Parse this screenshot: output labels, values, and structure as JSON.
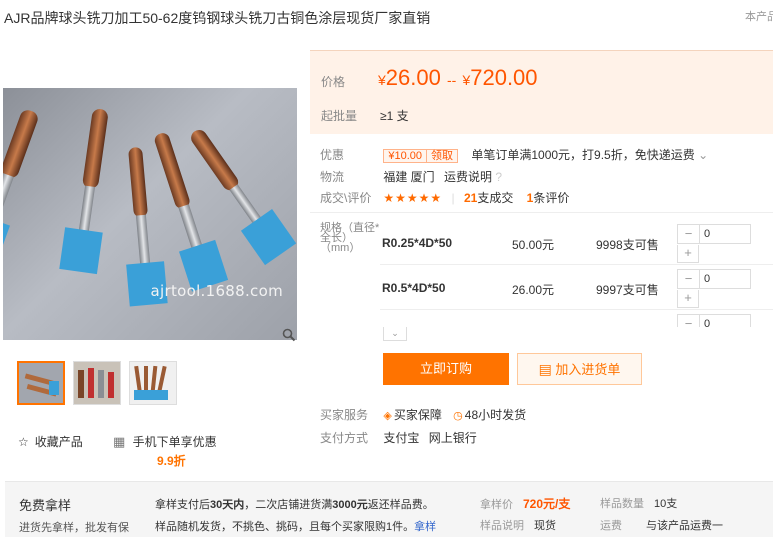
{
  "product": {
    "title": "AJR品牌球头铣刀加工50-62度钨钢球头铣刀古铜色涂层现货厂家直销",
    "corner_note": "本产品"
  },
  "gallery": {
    "watermark": "ajrtool.1688.com",
    "thumbs": [
      "thumb-1",
      "thumb-2",
      "thumb-3"
    ]
  },
  "actions": {
    "favorite_label": "收藏产品",
    "mobile_label": "手机下单享优惠",
    "mobile_discount": "9.9折"
  },
  "pricing": {
    "price_label": "价格",
    "price_low": "26.00",
    "price_sep": "--",
    "price_high": "720.00",
    "currency": "¥",
    "moq_label": "起批量",
    "moq_value": "≥1 支"
  },
  "info": {
    "promo_label": "优惠",
    "coupon_amount": "¥10.00",
    "coupon_action": "领取",
    "promo_text": "单笔订单满1000元，打9.5折，免快递运费",
    "logistics_label": "物流",
    "logistics_value": "福建 厦门",
    "freight_link": "运费说明",
    "deal_label": "成交\\评价",
    "stars": "★★★★★",
    "deal_count": "21",
    "deal_unit": "支成交",
    "review_count": "1",
    "review_unit": "条评价"
  },
  "specs": {
    "label_line1": "规格（直径*",
    "label_line2": "全长）",
    "label_line3": "（mm）",
    "rows": [
      {
        "name": "R0.25*4D*50",
        "price": "50.00元",
        "stock": "9998支可售",
        "qty": "0"
      },
      {
        "name": "R0.5*4D*50",
        "price": "26.00元",
        "stock": "9997支可售",
        "qty": "0"
      },
      {
        "name": "",
        "price": "",
        "stock": "",
        "qty": "0"
      }
    ]
  },
  "buttons": {
    "order": "立即订购",
    "cart": "加入进货单"
  },
  "service": {
    "buyer_label": "买家服务",
    "protect": "买家保障",
    "ship48": "48小时发货",
    "pay_label": "支付方式",
    "alipay": "支付宝",
    "bank": "网上银行"
  },
  "sample": {
    "title": "免费拿样",
    "subtitle": "进货先拿样，批发有保",
    "line1_pre": "拿样支付后",
    "line1_days": "30天内",
    "line1_mid": "，二次店铺进货满",
    "line1_amt": "3000元",
    "line1_post": "返还样品费。",
    "line2": "样品随机发货，不挑色、挑码，且每个买家限购1件。",
    "line2_link": "拿样",
    "price_label": "拿样价",
    "price_value": "720元/支",
    "qty_label": "样品数量",
    "qty_value": "10支",
    "note_label": "样品说明",
    "note_value": "现货",
    "freight_label": "运费",
    "freight_value": "与该产品运费一"
  },
  "colors": {
    "accent": "#ff7300",
    "price": "#ff5500",
    "price_bg": "#fff2e8"
  }
}
